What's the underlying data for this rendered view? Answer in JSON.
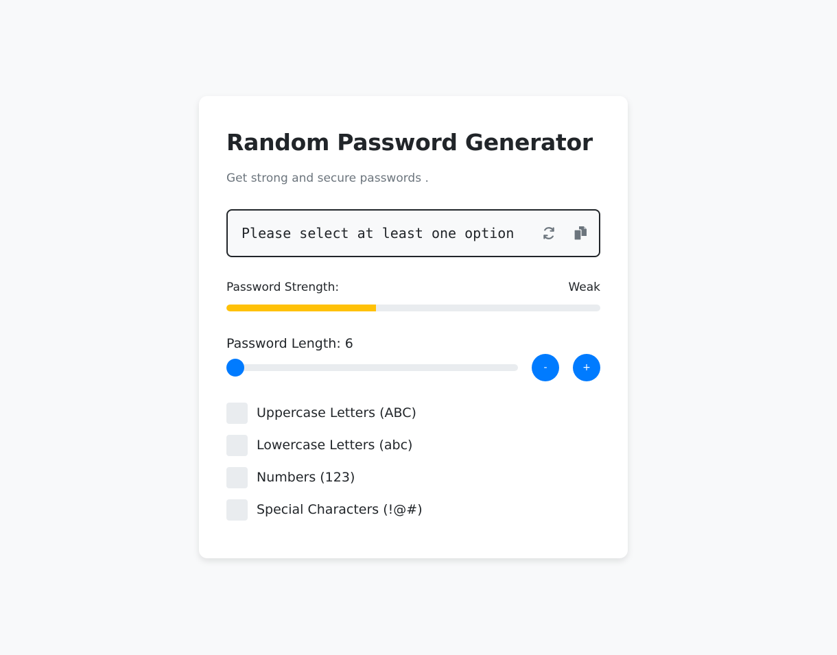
{
  "header": {
    "title": "Random Password Generator",
    "subtitle": "Get strong and secure passwords ."
  },
  "password": {
    "value": "Please select at least one option",
    "refresh_icon": "refresh-icon",
    "copy_icon": "copy-icon"
  },
  "strength": {
    "label": "Password Strength:",
    "value": "Weak",
    "level_fraction": 0.4,
    "color": "#ffc107"
  },
  "length": {
    "label": "Password Length: 6",
    "value": 6,
    "minus_label": "-",
    "plus_label": "+"
  },
  "options": [
    {
      "label": "Uppercase Letters (ABC)",
      "checked": false
    },
    {
      "label": "Lowercase Letters (abc)",
      "checked": false
    },
    {
      "label": "Numbers (123)",
      "checked": false
    },
    {
      "label": "Special Characters (!@#)",
      "checked": false
    }
  ],
  "colors": {
    "accent": "#007bff",
    "background": "#f8f9fa",
    "track": "#e9ecef"
  }
}
